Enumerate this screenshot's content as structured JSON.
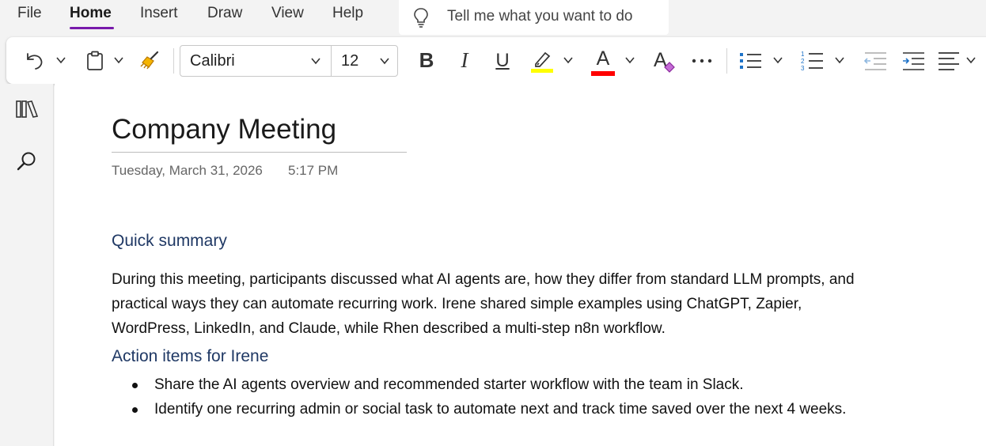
{
  "menu": {
    "items": [
      "File",
      "Home",
      "Insert",
      "Draw",
      "View",
      "Help"
    ],
    "active": "Home",
    "tell_me_placeholder": "Tell me what you want to do"
  },
  "ribbon": {
    "font_name": "Calibri",
    "font_size": "12",
    "bold_label": "B",
    "italic_label": "I",
    "underline_label": "U",
    "font_color_label": "A",
    "clear_format_label": "A",
    "highlight_color": "#ffff00",
    "font_color": "#ff0000",
    "accent_color": "#7719aa",
    "icons": [
      "undo-icon",
      "clipboard-icon",
      "format-painter-icon",
      "highlighter-icon",
      "font-color-icon",
      "clear-formatting-icon",
      "more-icon",
      "bullet-list-icon",
      "numbered-list-icon",
      "decrease-indent-icon",
      "increase-indent-icon",
      "align-icon"
    ]
  },
  "rail": {
    "icons": [
      "notebooks-icon",
      "search-icon"
    ]
  },
  "page": {
    "title": "Company Meeting",
    "date": "Tuesday, March 31, 2026",
    "time": "5:17 PM",
    "heading_color": "#1f3864",
    "sections": [
      {
        "heading": "Quick summary",
        "body": "During this meeting, participants discussed what AI agents are, how they differ from standard LLM prompts, and practical ways they can automate recurring work. Irene shared simple examples using ChatGPT, Zapier, WordPress, LinkedIn, and Claude, while Rhen described a multi-step n8n workflow."
      },
      {
        "heading": "Action items for Irene",
        "bullets": [
          "Share the AI agents overview and recommended starter workflow with the team in Slack.",
          "Identify one recurring admin or social task to automate next and track time saved over the next 4 weeks."
        ]
      }
    ]
  }
}
